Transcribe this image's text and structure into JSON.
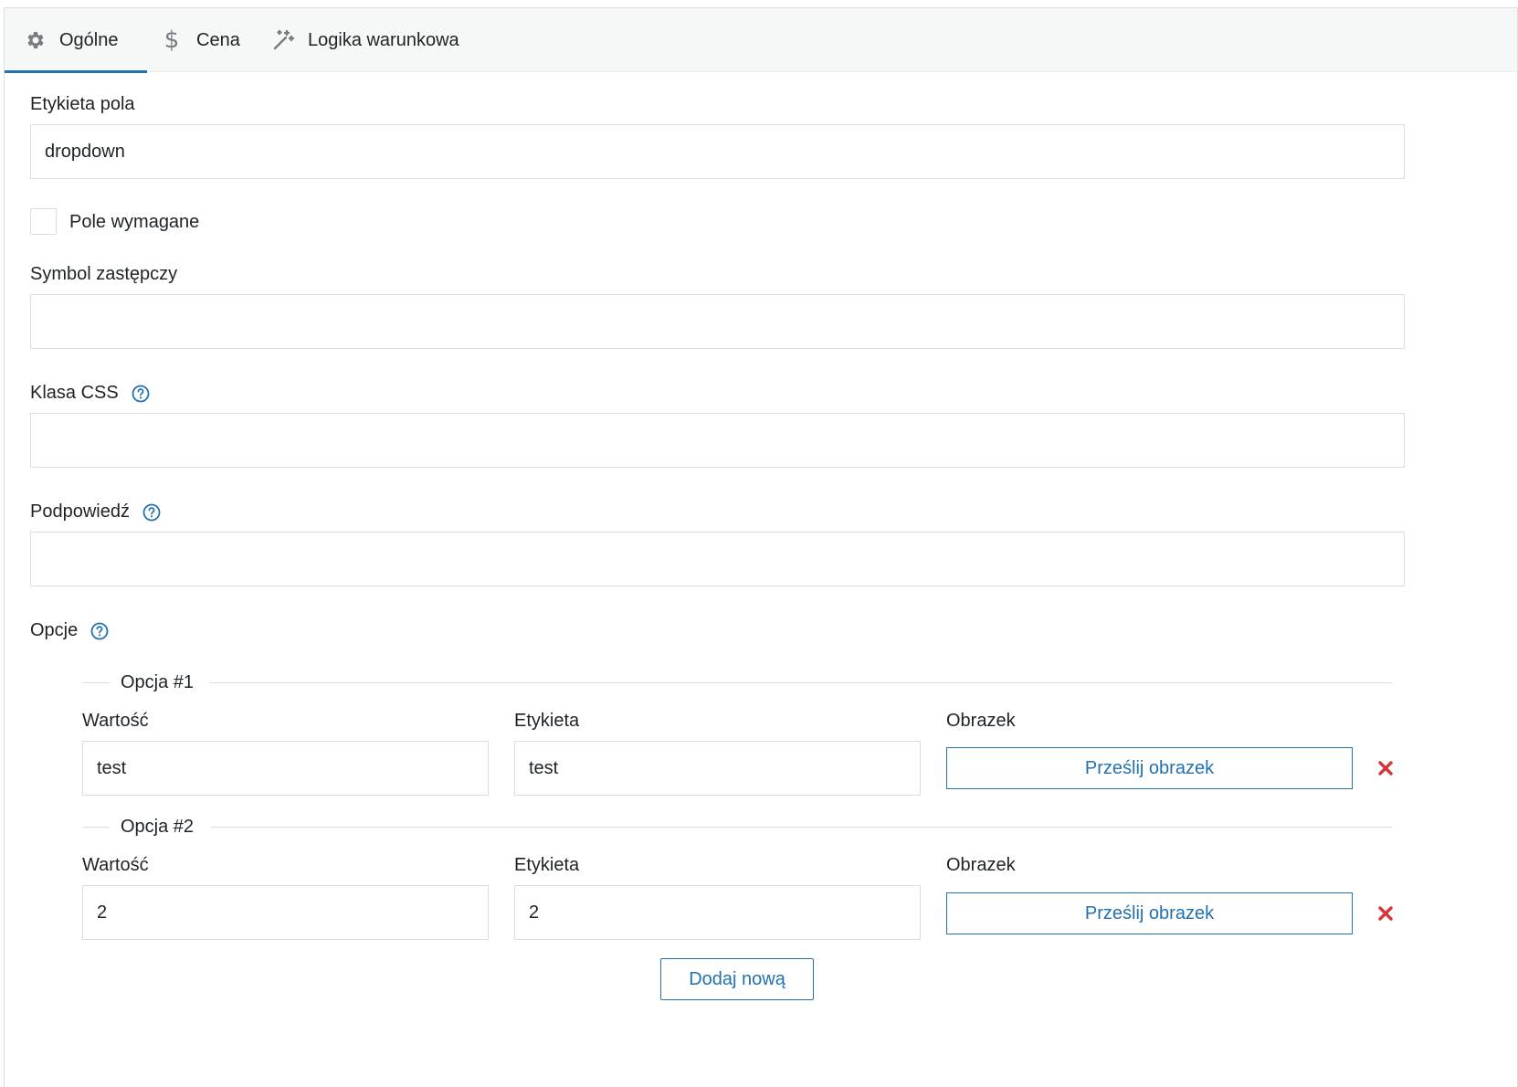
{
  "tabs": [
    {
      "label": "Ogólne",
      "icon": "gear-icon",
      "active": true
    },
    {
      "label": "Cena",
      "icon": "dollar-icon",
      "active": false
    },
    {
      "label": "Logika warunkowa",
      "icon": "magic-wand-icon",
      "active": false
    }
  ],
  "form": {
    "field_label": {
      "label": "Etykieta pola",
      "value": "dropdown"
    },
    "required": {
      "label": "Pole wymagane",
      "checked": false
    },
    "placeholder": {
      "label": "Symbol zastępczy",
      "value": ""
    },
    "css_class": {
      "label": "Klasa CSS",
      "value": "",
      "icon": "help-icon"
    },
    "hint": {
      "label": "Podpowiedź",
      "value": "",
      "icon": "help-icon"
    },
    "options_label": "Opcje"
  },
  "options": [
    {
      "legend": "Opcja #1",
      "value_label": "Wartość",
      "value": "test",
      "label_label": "Etykieta",
      "label": "test",
      "image_label": "Obrazek",
      "upload_label": "Prześlij obrazek"
    },
    {
      "legend": "Opcja #2",
      "value_label": "Wartość",
      "value": "2",
      "label_label": "Etykieta",
      "label": "2",
      "image_label": "Obrazek",
      "upload_label": "Prześlij obrazek"
    }
  ],
  "add_new_label": "Dodaj nową",
  "colors": {
    "accent": "#2271b1",
    "remove": "#d63638",
    "border": "#dcdcde",
    "tab_bg": "#f6f7f7"
  }
}
